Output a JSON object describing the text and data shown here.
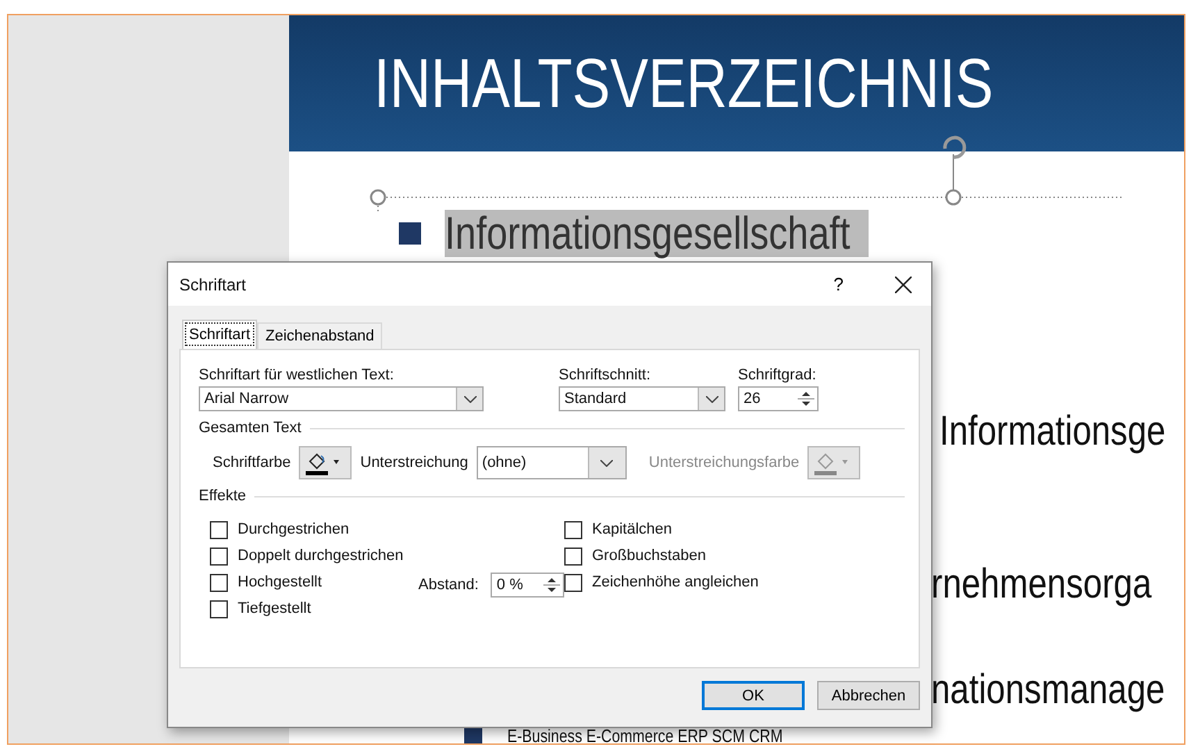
{
  "slide": {
    "title": "INHALTSVERZEICHNIS",
    "bullets": [
      {
        "text": "Informationsgesellschaft",
        "selected": true
      }
    ],
    "fragments": [
      "Informationsge",
      "rnehmensorga",
      "nationsmanage"
    ],
    "bottom_line": "E-Business  E-Commerce  ERP  SCM  CRM"
  },
  "dialog": {
    "title": "Schriftart",
    "help": "?",
    "tabs": [
      {
        "label": "Schriftart",
        "selected": true
      },
      {
        "label": "Zeichenabstand",
        "selected": false
      }
    ],
    "font": {
      "label": "Schriftart für westlichen Text:",
      "value": "Arial Narrow"
    },
    "style": {
      "label": "Schriftschnitt:",
      "value": "Standard"
    },
    "size": {
      "label": "Schriftgrad:",
      "value": "26"
    },
    "all_text": {
      "heading": "Gesamten Text",
      "font_color_label": "Schriftfarbe",
      "underline_label": "Unterstreichung",
      "underline_value": "(ohne)",
      "underline_color_label": "Unterstreichungsfarbe",
      "underline_color_disabled": true
    },
    "effects": {
      "heading": "Effekte",
      "left": [
        {
          "label": "Durchgestrichen",
          "checked": false
        },
        {
          "label": "Doppelt durchgestrichen",
          "checked": false
        },
        {
          "label": "Hochgestellt",
          "checked": false
        },
        {
          "label": "Tiefgestellt",
          "checked": false
        }
      ],
      "right": [
        {
          "label": "Kapitälchen",
          "checked": false
        },
        {
          "label": "Großbuchstaben",
          "checked": false
        },
        {
          "label": "Zeichenhöhe angleichen",
          "checked": false
        }
      ],
      "spacing_label": "Abstand:",
      "spacing_value": "0 %"
    },
    "buttons": [
      {
        "label": "OK",
        "default": true
      },
      {
        "label": "Abbrechen",
        "default": false
      }
    ]
  }
}
